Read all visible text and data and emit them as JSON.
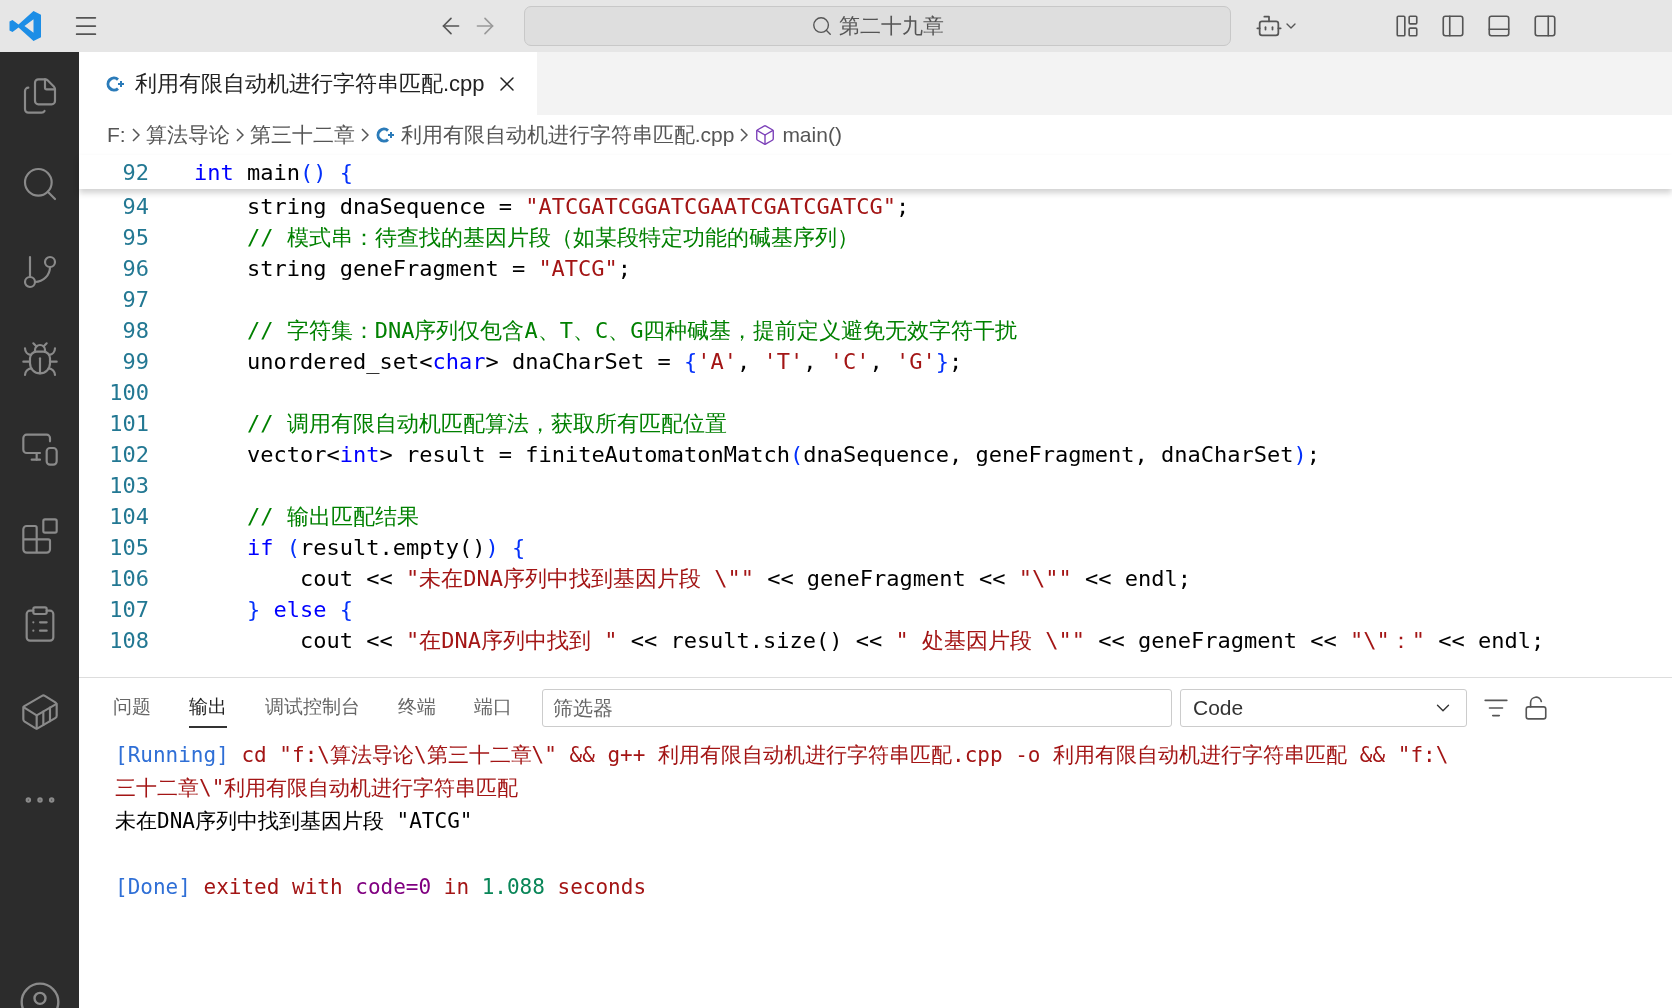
{
  "title_bar": {
    "search": "第二十九章"
  },
  "editor_tabs": [
    {
      "label": "利用有限自动机进行字符串匹配.cpp",
      "selected": true
    }
  ],
  "breadcrumb": [
    {
      "kind": "folder",
      "label": "F:"
    },
    {
      "kind": "folder",
      "label": "算法导论"
    },
    {
      "kind": "folder",
      "label": "第三十二章"
    },
    {
      "kind": "file",
      "label": "利用有限自动机进行字符串匹配.cpp"
    },
    {
      "kind": "symbol",
      "label": "main()"
    }
  ],
  "sticky_line": {
    "number": "92",
    "tokens": [
      {
        "kind": "keyword",
        "text": "int"
      },
      {
        "kind": "plain",
        "text": " main"
      },
      {
        "kind": "bracket",
        "text": "() {"
      }
    ]
  },
  "code_lines": [
    {
      "number": "94",
      "tokens": [
        {
          "kind": "plain",
          "text": "    string dnaSequence = "
        },
        {
          "kind": "string",
          "text": "\"ATCGATCGGATCGAATCGATCGATCG\""
        },
        {
          "kind": "plain",
          "text": ";"
        }
      ]
    },
    {
      "number": "95",
      "tokens": [
        {
          "kind": "comment",
          "text": "    // 模式串：待查找的基因片段（如某段特定功能的碱基序列）"
        }
      ]
    },
    {
      "number": "96",
      "tokens": [
        {
          "kind": "plain",
          "text": "    string geneFragment = "
        },
        {
          "kind": "string",
          "text": "\"ATCG\""
        },
        {
          "kind": "plain",
          "text": ";"
        }
      ]
    },
    {
      "number": "97"
    },
    {
      "number": "98",
      "tokens": [
        {
          "kind": "comment",
          "text": "    // 字符集：DNA序列仅包含A、T、C、G四种碱基，提前定义避免无效字符干扰"
        }
      ]
    },
    {
      "number": "99",
      "tokens": [
        {
          "kind": "plain",
          "text": "    unordered_set<"
        },
        {
          "kind": "keyword",
          "text": "char"
        },
        {
          "kind": "plain",
          "text": "> dnaCharSet = "
        },
        {
          "kind": "bracket",
          "text": "{"
        },
        {
          "kind": "string",
          "text": "'A'"
        },
        {
          "kind": "plain",
          "text": ", "
        },
        {
          "kind": "string",
          "text": "'T'"
        },
        {
          "kind": "plain",
          "text": ", "
        },
        {
          "kind": "string",
          "text": "'C'"
        },
        {
          "kind": "plain",
          "text": ", "
        },
        {
          "kind": "string",
          "text": "'G'"
        },
        {
          "kind": "bracket",
          "text": "}"
        },
        {
          "kind": "plain",
          "text": ";"
        }
      ]
    },
    {
      "number": "100"
    },
    {
      "number": "101",
      "tokens": [
        {
          "kind": "comment",
          "text": "    // 调用有限自动机匹配算法，获取所有匹配位置"
        }
      ]
    },
    {
      "number": "102",
      "tokens": [
        {
          "kind": "plain",
          "text": "    vector<"
        },
        {
          "kind": "keyword",
          "text": "int"
        },
        {
          "kind": "plain",
          "text": "> result = finiteAutomatonMatch"
        },
        {
          "kind": "bracket",
          "text": "("
        },
        {
          "kind": "plain",
          "text": "dnaSequence, geneFragment, dnaCharSet"
        },
        {
          "kind": "bracket",
          "text": ")"
        },
        {
          "kind": "plain",
          "text": ";"
        }
      ]
    },
    {
      "number": "103"
    },
    {
      "number": "104",
      "tokens": [
        {
          "kind": "comment",
          "text": "    // 输出匹配结果"
        }
      ]
    },
    {
      "number": "105",
      "tokens": [
        {
          "kind": "keyword",
          "text": "    if"
        },
        {
          "kind": "bracket",
          "text": " ("
        },
        {
          "kind": "plain",
          "text": "result.empty()"
        },
        {
          "kind": "bracket",
          "text": ") {"
        }
      ]
    },
    {
      "number": "106",
      "tokens": [
        {
          "kind": "plain",
          "text": "        cout << "
        },
        {
          "kind": "string",
          "text": "\"未在DNA序列中找到基因片段 \\\"\""
        },
        {
          "kind": "plain",
          "text": " << geneFragment << "
        },
        {
          "kind": "string",
          "text": "\"\\\"\""
        },
        {
          "kind": "plain",
          "text": " << endl;"
        }
      ]
    },
    {
      "number": "107",
      "tokens": [
        {
          "kind": "bracket",
          "text": "    }"
        },
        {
          "kind": "keyword",
          "text": " else"
        },
        {
          "kind": "bracket",
          "text": " {"
        }
      ]
    },
    {
      "number": "108",
      "tokens": [
        {
          "kind": "plain",
          "text": "        cout << "
        },
        {
          "kind": "string",
          "text": "\"在DNA序列中找到 \""
        },
        {
          "kind": "plain",
          "text": " << result.size() << "
        },
        {
          "kind": "string",
          "text": "\" 处基因片段 \\\"\""
        },
        {
          "kind": "plain",
          "text": " << geneFragment << "
        },
        {
          "kind": "string",
          "text": "\"\\\"：\""
        },
        {
          "kind": "plain",
          "text": " << endl;"
        }
      ]
    }
  ],
  "panel": {
    "tabs": [
      {
        "label": "问题",
        "selected": false
      },
      {
        "label": "输出",
        "selected": true
      },
      {
        "label": "调试控制台",
        "selected": false
      },
      {
        "label": "终端",
        "selected": false
      },
      {
        "label": "端口",
        "selected": false
      }
    ],
    "filter": {
      "placeholder": "筛选器"
    },
    "channel": "Code",
    "output": [
      {
        "kind": "line",
        "tokens": [
          {
            "kind": "tag",
            "text": "[Running]"
          },
          {
            "kind": "text",
            "text": " cd \"f:\\算法导论\\第三十二章\\\" && g++ 利用有限自动机进行字符串匹配.cpp -o 利用有限自动机进行字符串匹配 && \"f:\\"
          }
        ]
      },
      {
        "kind": "line",
        "tokens": [
          {
            "kind": "text",
            "text": "三十二章\\\"利用有限自动机进行字符串匹配"
          }
        ]
      },
      {
        "kind": "line",
        "tokens": [
          {
            "kind": "plain",
            "text": "未在DNA序列中找到基因片段 \"ATCG\""
          }
        ]
      },
      {
        "kind": "blank"
      },
      {
        "kind": "line",
        "tokens": [
          {
            "kind": "tag",
            "text": "[Done]"
          },
          {
            "kind": "text",
            "text": " exited with "
          },
          {
            "kind": "key",
            "text": "code=0"
          },
          {
            "kind": "text",
            "text": " in "
          },
          {
            "kind": "number",
            "text": "1.088"
          },
          {
            "kind": "text",
            "text": " seconds"
          }
        ]
      }
    ]
  }
}
